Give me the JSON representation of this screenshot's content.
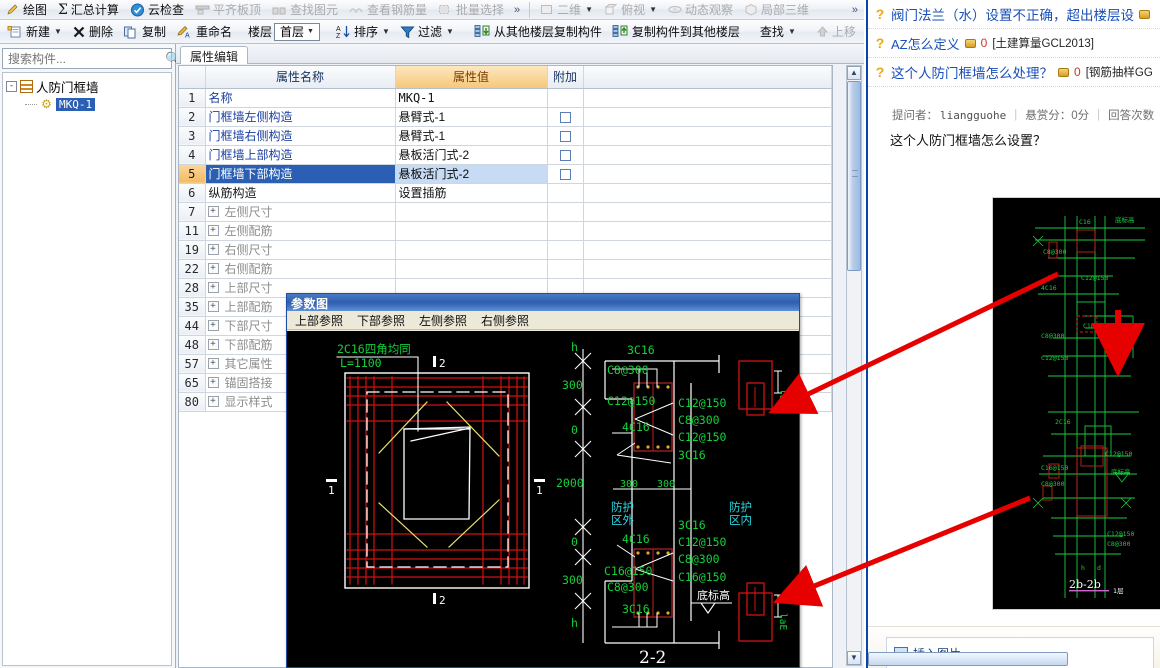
{
  "ribbon": {
    "items": [
      {
        "label": "绘图",
        "icon": "pencil-icon",
        "dim": false
      },
      {
        "label": "汇总计算",
        "icon": "sigma-icon",
        "dim": false
      },
      {
        "label": "云检查",
        "icon": "cloud-check-icon",
        "dim": false
      },
      {
        "label": "平齐板顶",
        "icon": "align-slab-icon",
        "dim": true
      },
      {
        "label": "查找图元",
        "icon": "find-element-icon",
        "dim": true
      },
      {
        "label": "查看钢筋量",
        "icon": "view-rebar-icon",
        "dim": true
      },
      {
        "label": "批量选择",
        "icon": "batch-select-icon",
        "dim": true
      },
      {
        "label": "二维",
        "icon": "view-2d-icon",
        "dim": true
      },
      {
        "label": "俯视",
        "icon": "top-view-icon",
        "dim": true
      },
      {
        "label": "动态观察",
        "icon": "orbit-icon",
        "dim": true
      },
      {
        "label": "局部三维",
        "icon": "local-3d-icon",
        "dim": true
      }
    ],
    "overflow": "»"
  },
  "toolbar": {
    "new_label": "新建",
    "delete_label": "删除",
    "copy_label": "复制",
    "rename_label": "重命名",
    "floor_label": "楼层",
    "floor_value": "首层",
    "sort_label": "排序",
    "filter_label": "过滤",
    "copy_from_other_floor_label": "从其他楼层复制构件",
    "copy_to_other_floor_label": "复制构件到其他楼层",
    "find_label": "查找",
    "move_up_label": "上移",
    "overflow": "»"
  },
  "left_panel": {
    "search_placeholder": "搜索构件...",
    "search_value": "",
    "search_icon": "search-icon",
    "tree": {
      "root_label": "人防门框墙",
      "root_icon": "wall-icon",
      "child_label": "MKQ-1",
      "child_icon": "component-gear-icon",
      "expander": "-"
    }
  },
  "grid": {
    "tab_label": "属性编辑",
    "columns": [
      "",
      "属性名称",
      "属性值",
      "附加",
      ""
    ],
    "rows": [
      {
        "idx": "1",
        "name": "名称",
        "value": "MKQ-1",
        "attach": false,
        "type": "link",
        "selected": false,
        "mono": true
      },
      {
        "idx": "2",
        "name": "门框墙左侧构造",
        "value": "悬臂式-1",
        "attach": true,
        "type": "link",
        "selected": false
      },
      {
        "idx": "3",
        "name": "门框墙右侧构造",
        "value": "悬臂式-1",
        "attach": true,
        "type": "link",
        "selected": false
      },
      {
        "idx": "4",
        "name": "门框墙上部构造",
        "value": "悬板活门式-2",
        "attach": true,
        "type": "link",
        "selected": false
      },
      {
        "idx": "5",
        "name": "门框墙下部构造",
        "value": "悬板活门式-2",
        "attach": true,
        "type": "link",
        "selected": true
      },
      {
        "idx": "6",
        "name": "纵筋构造",
        "value": "设置插筋",
        "attach": false,
        "type": "plain",
        "selected": false
      },
      {
        "idx": "7",
        "name": "左侧尺寸",
        "value": "",
        "attach": null,
        "type": "group",
        "selected": false
      },
      {
        "idx": "11",
        "name": "左侧配筋",
        "value": "",
        "attach": null,
        "type": "group",
        "selected": false
      },
      {
        "idx": "19",
        "name": "右侧尺寸",
        "value": "",
        "attach": null,
        "type": "group",
        "selected": false
      },
      {
        "idx": "22",
        "name": "右侧配筋",
        "value": "",
        "attach": null,
        "type": "group",
        "selected": false
      },
      {
        "idx": "28",
        "name": "上部尺寸",
        "value": "",
        "attach": null,
        "type": "group",
        "selected": false
      },
      {
        "idx": "35",
        "name": "上部配筋",
        "value": "",
        "attach": null,
        "type": "group",
        "selected": false
      },
      {
        "idx": "44",
        "name": "下部尺寸",
        "value": "",
        "attach": null,
        "type": "group",
        "selected": false
      },
      {
        "idx": "48",
        "name": "下部配筋",
        "value": "",
        "attach": null,
        "type": "group",
        "selected": false
      },
      {
        "idx": "57",
        "name": "其它属性",
        "value": "",
        "attach": null,
        "type": "group",
        "selected": false
      },
      {
        "idx": "65",
        "name": "锚固搭接",
        "value": "",
        "attach": null,
        "type": "group",
        "selected": false
      },
      {
        "idx": "80",
        "name": "显示样式",
        "value": "",
        "attach": null,
        "type": "group",
        "selected": false
      }
    ],
    "expander_glyph": "+"
  },
  "param_window": {
    "title": "参数图",
    "menu": [
      "上部参照",
      "下部参照",
      "左侧参照",
      "右侧参照"
    ],
    "drawing": {
      "left_view": {
        "label_top": "2C16四角均同",
        "label_len": "L=1100",
        "section_marks": [
          "2",
          "2",
          "1",
          "1"
        ]
      },
      "right_view": {
        "title": "2-2",
        "dim_column": [
          "h",
          "300",
          "0",
          "2000",
          "0",
          "300",
          "h"
        ],
        "zone_outer": "防护\n区外",
        "zone_inner": "防护\n区内",
        "labels_left": [
          "C8@300",
          "C12@150",
          "4C16",
          "C16@150",
          "C8@300",
          "3C16"
        ],
        "labels_top": [
          "3C16"
        ],
        "labels_right": [
          "C12@150",
          "C8@300",
          "C12@150",
          "3C16"
        ],
        "labels_bottom_right": [
          "3C16",
          "C12@150",
          "C8@300",
          "C16@150"
        ],
        "labels_bottom_left": [
          "4C16"
        ],
        "dims_small": [
          "300",
          "300"
        ],
        "bottom_elev_label": "底标高",
        "anchor_label": "laE"
      }
    }
  },
  "right_panel": {
    "questions": [
      {
        "icon": "question-icon",
        "title": "阀门法兰（水）设置不正确，超出楼层设",
        "coin": true,
        "count": "",
        "category": ""
      },
      {
        "icon": "question-icon",
        "title": "AZ怎么定义",
        "coin": true,
        "count": "0",
        "category": "[土建算量GCL2013]"
      },
      {
        "icon": "question-icon",
        "title": "这个人防门框墙怎么处理？",
        "coin": true,
        "count": "0",
        "category": "[钢筋抽样GG"
      }
    ],
    "meta": {
      "asker_label": "提问者：",
      "asker_name": "liangguohe",
      "bounty_label": "悬赏分：0分",
      "answers_label": "回答次数"
    },
    "body_text": "这个人防门框墙怎么设置？",
    "attached_image": {
      "caption": "2b-2b",
      "notes": [
        "1层"
      ]
    },
    "footer": {
      "insert_image_label": "插入图片",
      "icon": "picture-icon"
    }
  },
  "colors": {
    "accent_blue": "#2a5fb4",
    "header_orange": "#f6c87a",
    "link_blue": "#1a3fa0",
    "selection_blue": "#2a5fb4",
    "cad_green": "#00cc33",
    "cad_red": "#cc1111",
    "cad_cyan": "#33cccc",
    "arrow_red": "#e60000",
    "right_border": "#0a44a8"
  }
}
